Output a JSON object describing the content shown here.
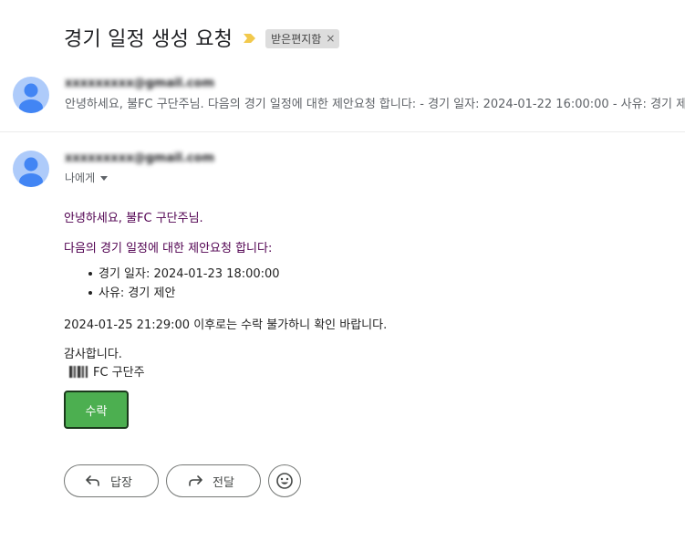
{
  "thread": {
    "subject": "경기 일정 생성 요청",
    "label": "받은편지함",
    "label_remove": "×"
  },
  "collapsed_message": {
    "sender": "xxxxxxxxx@gmail.com",
    "snippet": "안녕하세요, 불FC 구단주님. 다음의 경기 일정에 대한 제안요청 합니다: - 경기 일자: 2024-01-22 16:00:00 - 사유: 경기 제"
  },
  "expanded_message": {
    "sender": "xxxxxxxxx@gmail.com",
    "recipient": "나에게",
    "greeting": "안녕하세요, 불FC 구단주님.",
    "intro": "다음의 경기 일정에 대한 제안요청 합니다:",
    "details": [
      "경기 일자: 2024-01-23 18:00:00",
      "사유: 경기 제안"
    ],
    "deadline": "2024-01-25 21:29:00 이후로는 수락 불가하니 확인 바랍니다.",
    "closing": "감사합니다.",
    "signature": "FC 구단주",
    "accept_label": "수락"
  },
  "actions": {
    "reply_label": "답장",
    "forward_label": "전달"
  },
  "colors": {
    "label_arrow": "#f2c94c",
    "accept_button": "#4caf50",
    "quoted_text": "#500050",
    "avatar_bg": "#aecbfa",
    "avatar_fg": "#4285f4"
  },
  "icons": {
    "label_marker": "label-arrow-icon",
    "avatar": "person-avatar-icon",
    "reply": "reply-arrow-icon",
    "forward": "forward-arrow-icon",
    "emoji": "smiley-face-icon",
    "recipient_details": "caret-down-icon"
  }
}
